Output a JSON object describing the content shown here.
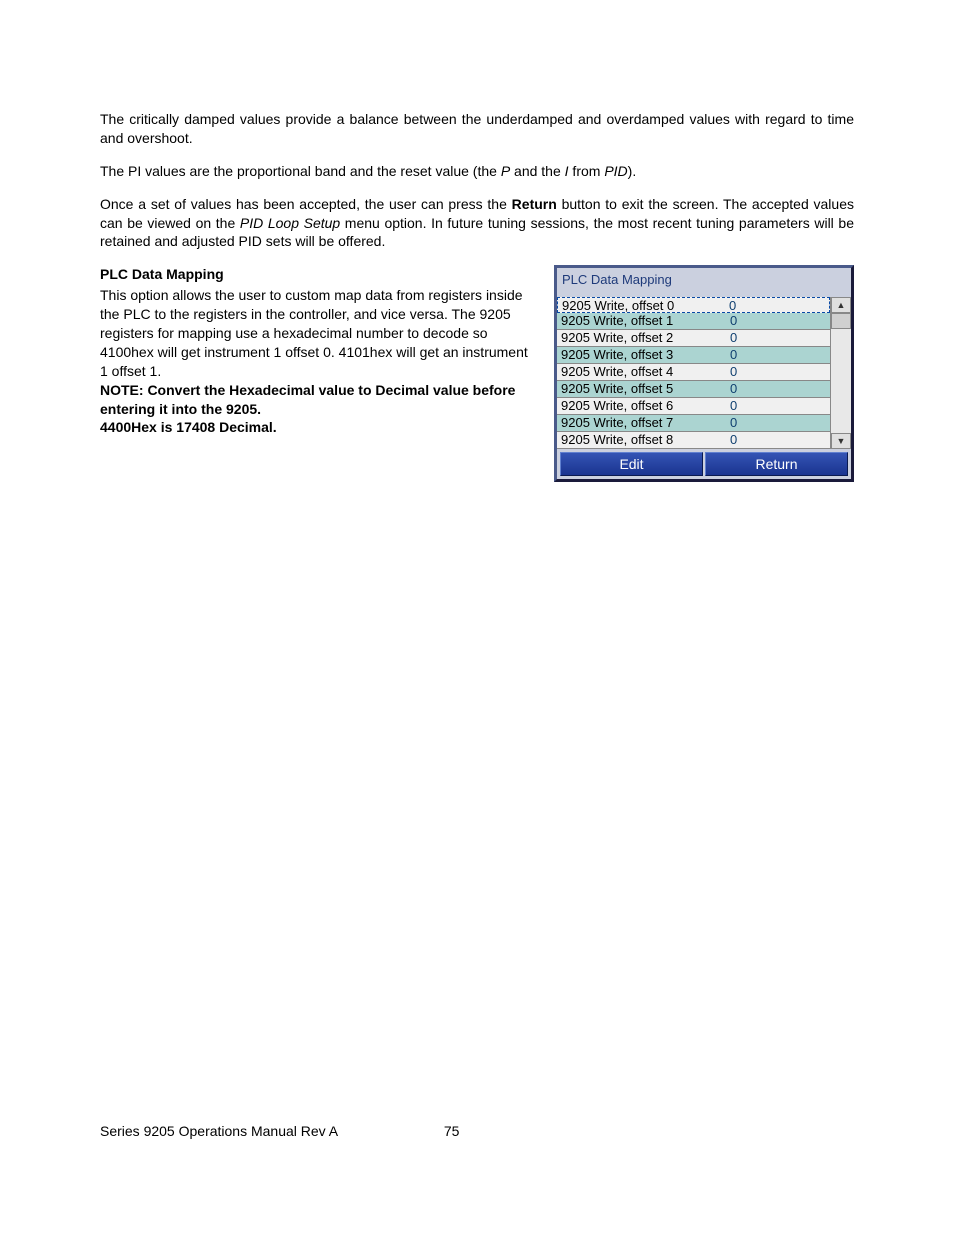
{
  "paragraphs": {
    "p1": "The critically damped values provide a balance between the underdamped and overdamped values with regard to time and overshoot.",
    "p2_a": "The PI values are the proportional band and the reset value (the ",
    "p2_b": "P",
    "p2_c": " and the ",
    "p2_d": "I",
    "p2_e": " from ",
    "p2_f": "PID",
    "p2_g": ").",
    "p3_a": "Once a set of values has been accepted, the user can press the ",
    "p3_b": "Return",
    "p3_c": " button to exit the screen.  The accepted values can be viewed on the ",
    "p3_d": "PID Loop Setup",
    "p3_e": " menu option.  In future tuning sessions, the most recent tuning parameters will be retained and adjusted PID sets will be offered."
  },
  "section": {
    "heading": "PLC Data Mapping",
    "body": "This option allows the user to custom map data from registers inside the PLC to the registers in the controller, and vice versa.  The 9205 registers for mapping use a hexadecimal number to decode so 4100hex will get instrument 1 offset 0.  4101hex will get an instrument 1 offset 1.",
    "note1": "NOTE: Convert the Hexadecimal value to Decimal value before entering it into the 9205.",
    "note2": "4400Hex is 17408 Decimal."
  },
  "panel": {
    "title": "PLC Data Mapping",
    "rows": [
      {
        "label": "9205 Write, offset 0",
        "value": "0"
      },
      {
        "label": "9205 Write, offset 1",
        "value": "0"
      },
      {
        "label": "9205 Write, offset 2",
        "value": "0"
      },
      {
        "label": "9205 Write, offset 3",
        "value": "0"
      },
      {
        "label": "9205 Write, offset 4",
        "value": "0"
      },
      {
        "label": "9205 Write, offset 5",
        "value": "0"
      },
      {
        "label": "9205 Write, offset 6",
        "value": "0"
      },
      {
        "label": "9205 Write, offset 7",
        "value": "0"
      },
      {
        "label": "9205 Write, offset 8",
        "value": "0"
      }
    ],
    "buttons": {
      "edit": "Edit",
      "return": "Return"
    }
  },
  "footer": {
    "left": "Series 9205 Operations Manual Rev A",
    "page": "75"
  }
}
